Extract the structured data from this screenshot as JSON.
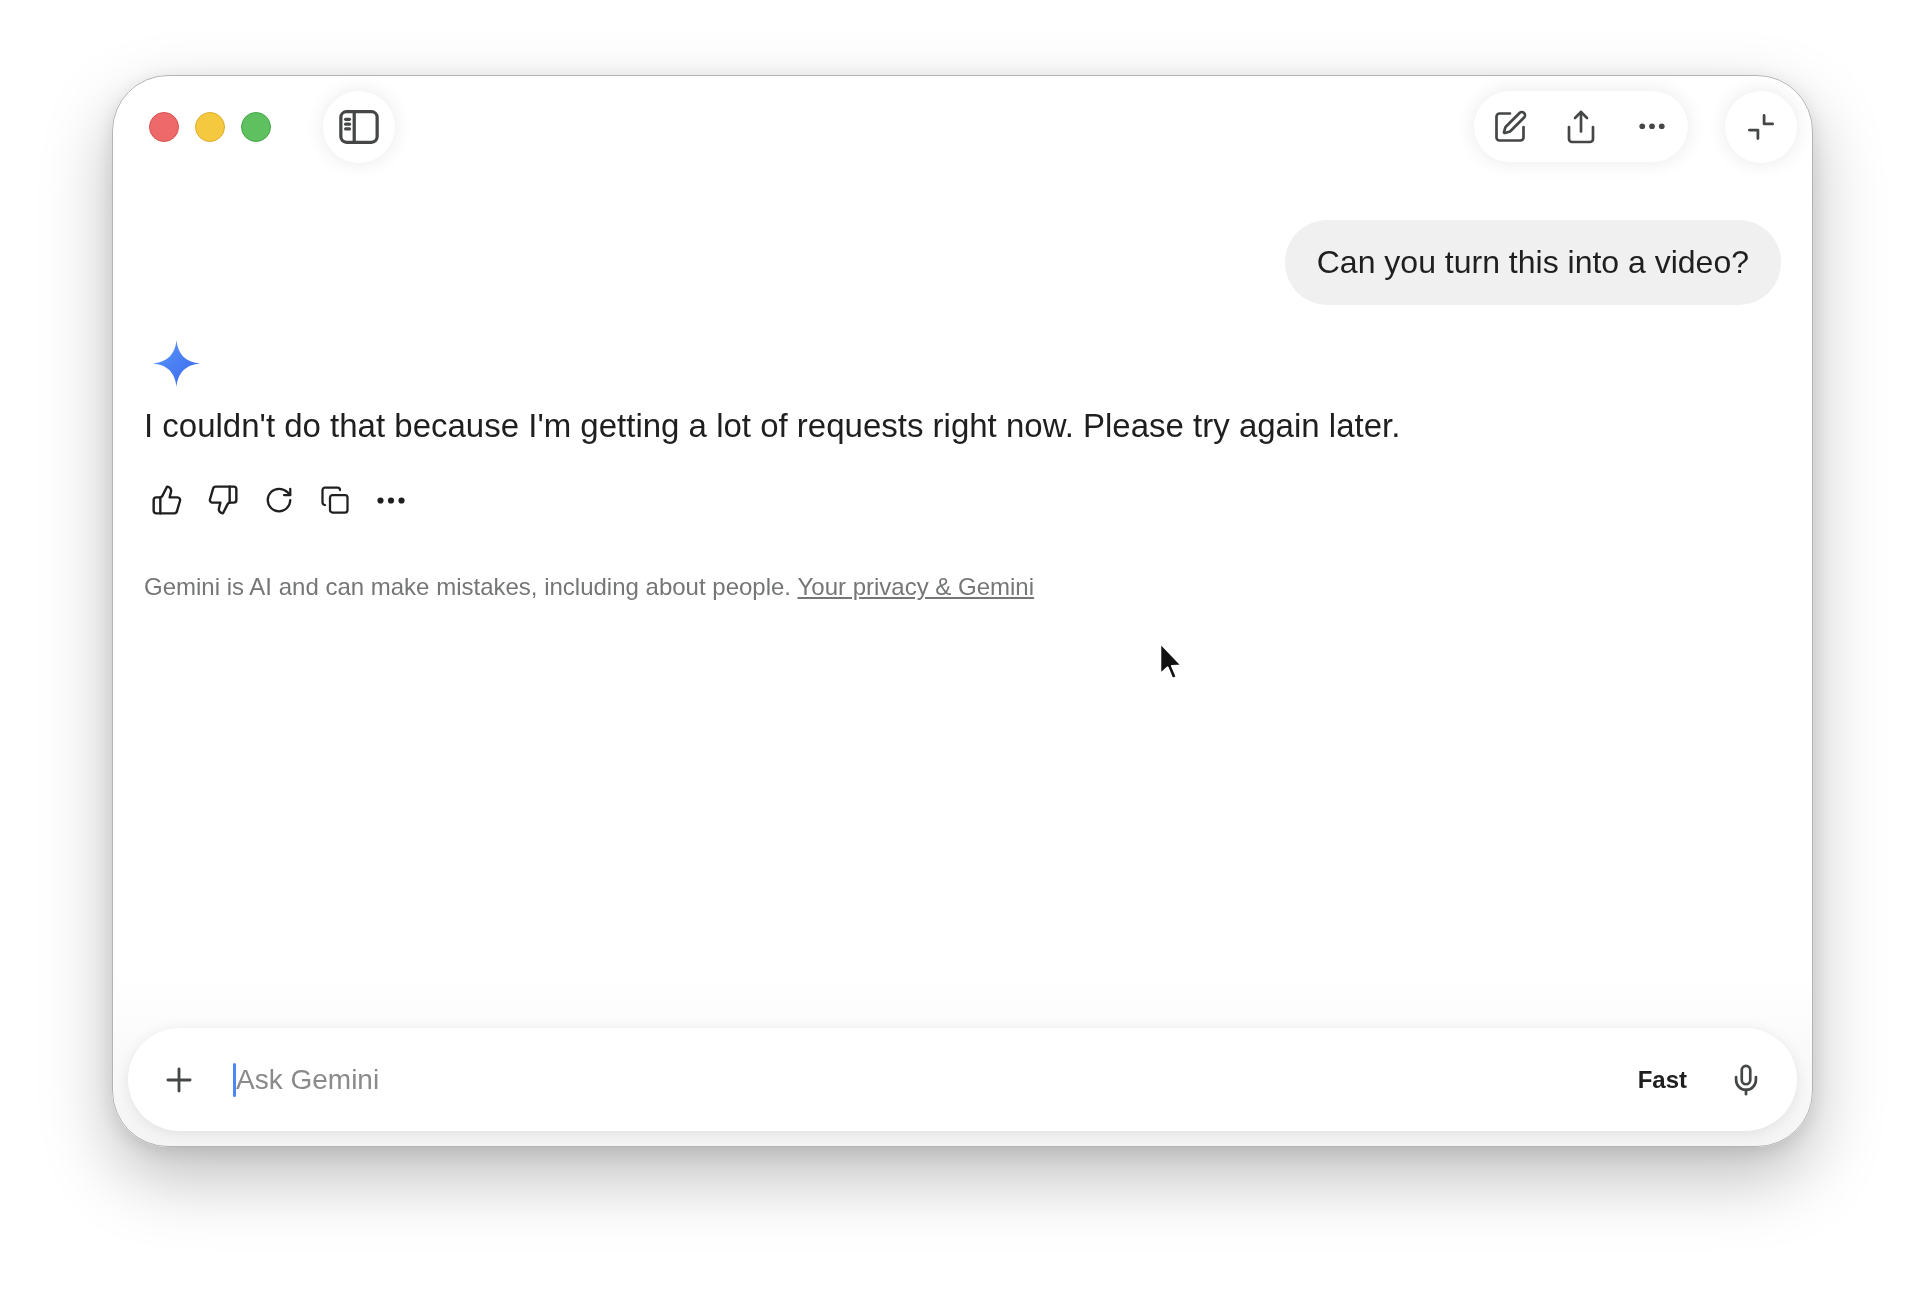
{
  "conversation": {
    "user_message": "Can you turn this into a video?",
    "response": {
      "text": "I couldn't do that because I'm getting a lot of requests right now. Please try again later."
    }
  },
  "disclaimer": {
    "text": "Gemini is AI and can make mistakes, including about people.",
    "link": "Your privacy & Gemini"
  },
  "prompt_bar": {
    "placeholder": "Ask Gemini",
    "mode": "Fast"
  }
}
